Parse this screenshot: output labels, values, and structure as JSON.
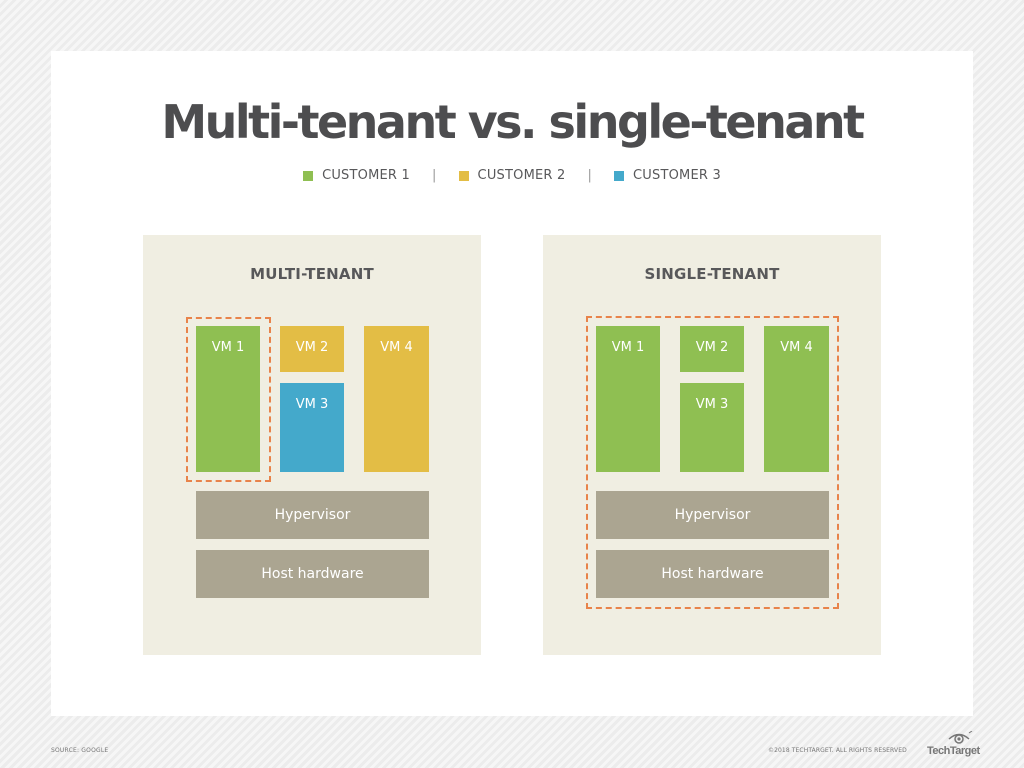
{
  "title": "Multi-tenant vs. single-tenant",
  "legend": [
    {
      "label": "CUSTOMER 1",
      "color": "#8fbf52"
    },
    {
      "label": "CUSTOMER 2",
      "color": "#e3bd45"
    },
    {
      "label": "CUSTOMER 3",
      "color": "#44a9cb"
    }
  ],
  "legend_separator": "|",
  "panels": {
    "multi": {
      "title": "MULTI-TENANT",
      "vms": [
        {
          "label": "VM 1",
          "customer": 1,
          "color": "#8fbf52"
        },
        {
          "label": "VM 2",
          "customer": 2,
          "color": "#e3bd45"
        },
        {
          "label": "VM 3",
          "customer": 3,
          "color": "#44a9cb"
        },
        {
          "label": "VM 4",
          "customer": 2,
          "color": "#e3bd45"
        }
      ],
      "hypervisor": "Hypervisor",
      "hardware": "Host hardware",
      "highlight": "VM 1 only"
    },
    "single": {
      "title": "SINGLE-TENANT",
      "vms": [
        {
          "label": "VM 1",
          "customer": 1,
          "color": "#8fbf52"
        },
        {
          "label": "VM 2",
          "customer": 1,
          "color": "#8fbf52"
        },
        {
          "label": "VM 3",
          "customer": 1,
          "color": "#8fbf52"
        },
        {
          "label": "VM 4",
          "customer": 1,
          "color": "#8fbf52"
        }
      ],
      "hypervisor": "Hypervisor",
      "hardware": "Host hardware",
      "highlight": "entire stack"
    }
  },
  "colors": {
    "highlight_border": "#e8834a",
    "layer": "#aba591",
    "panel_bg": "#f0eee2"
  },
  "footer": {
    "source": "SOURCE: GOOGLE",
    "copyright": "©2018 TECHTARGET. ALL RIGHTS RESERVED",
    "logo_text": "TechTarget"
  }
}
